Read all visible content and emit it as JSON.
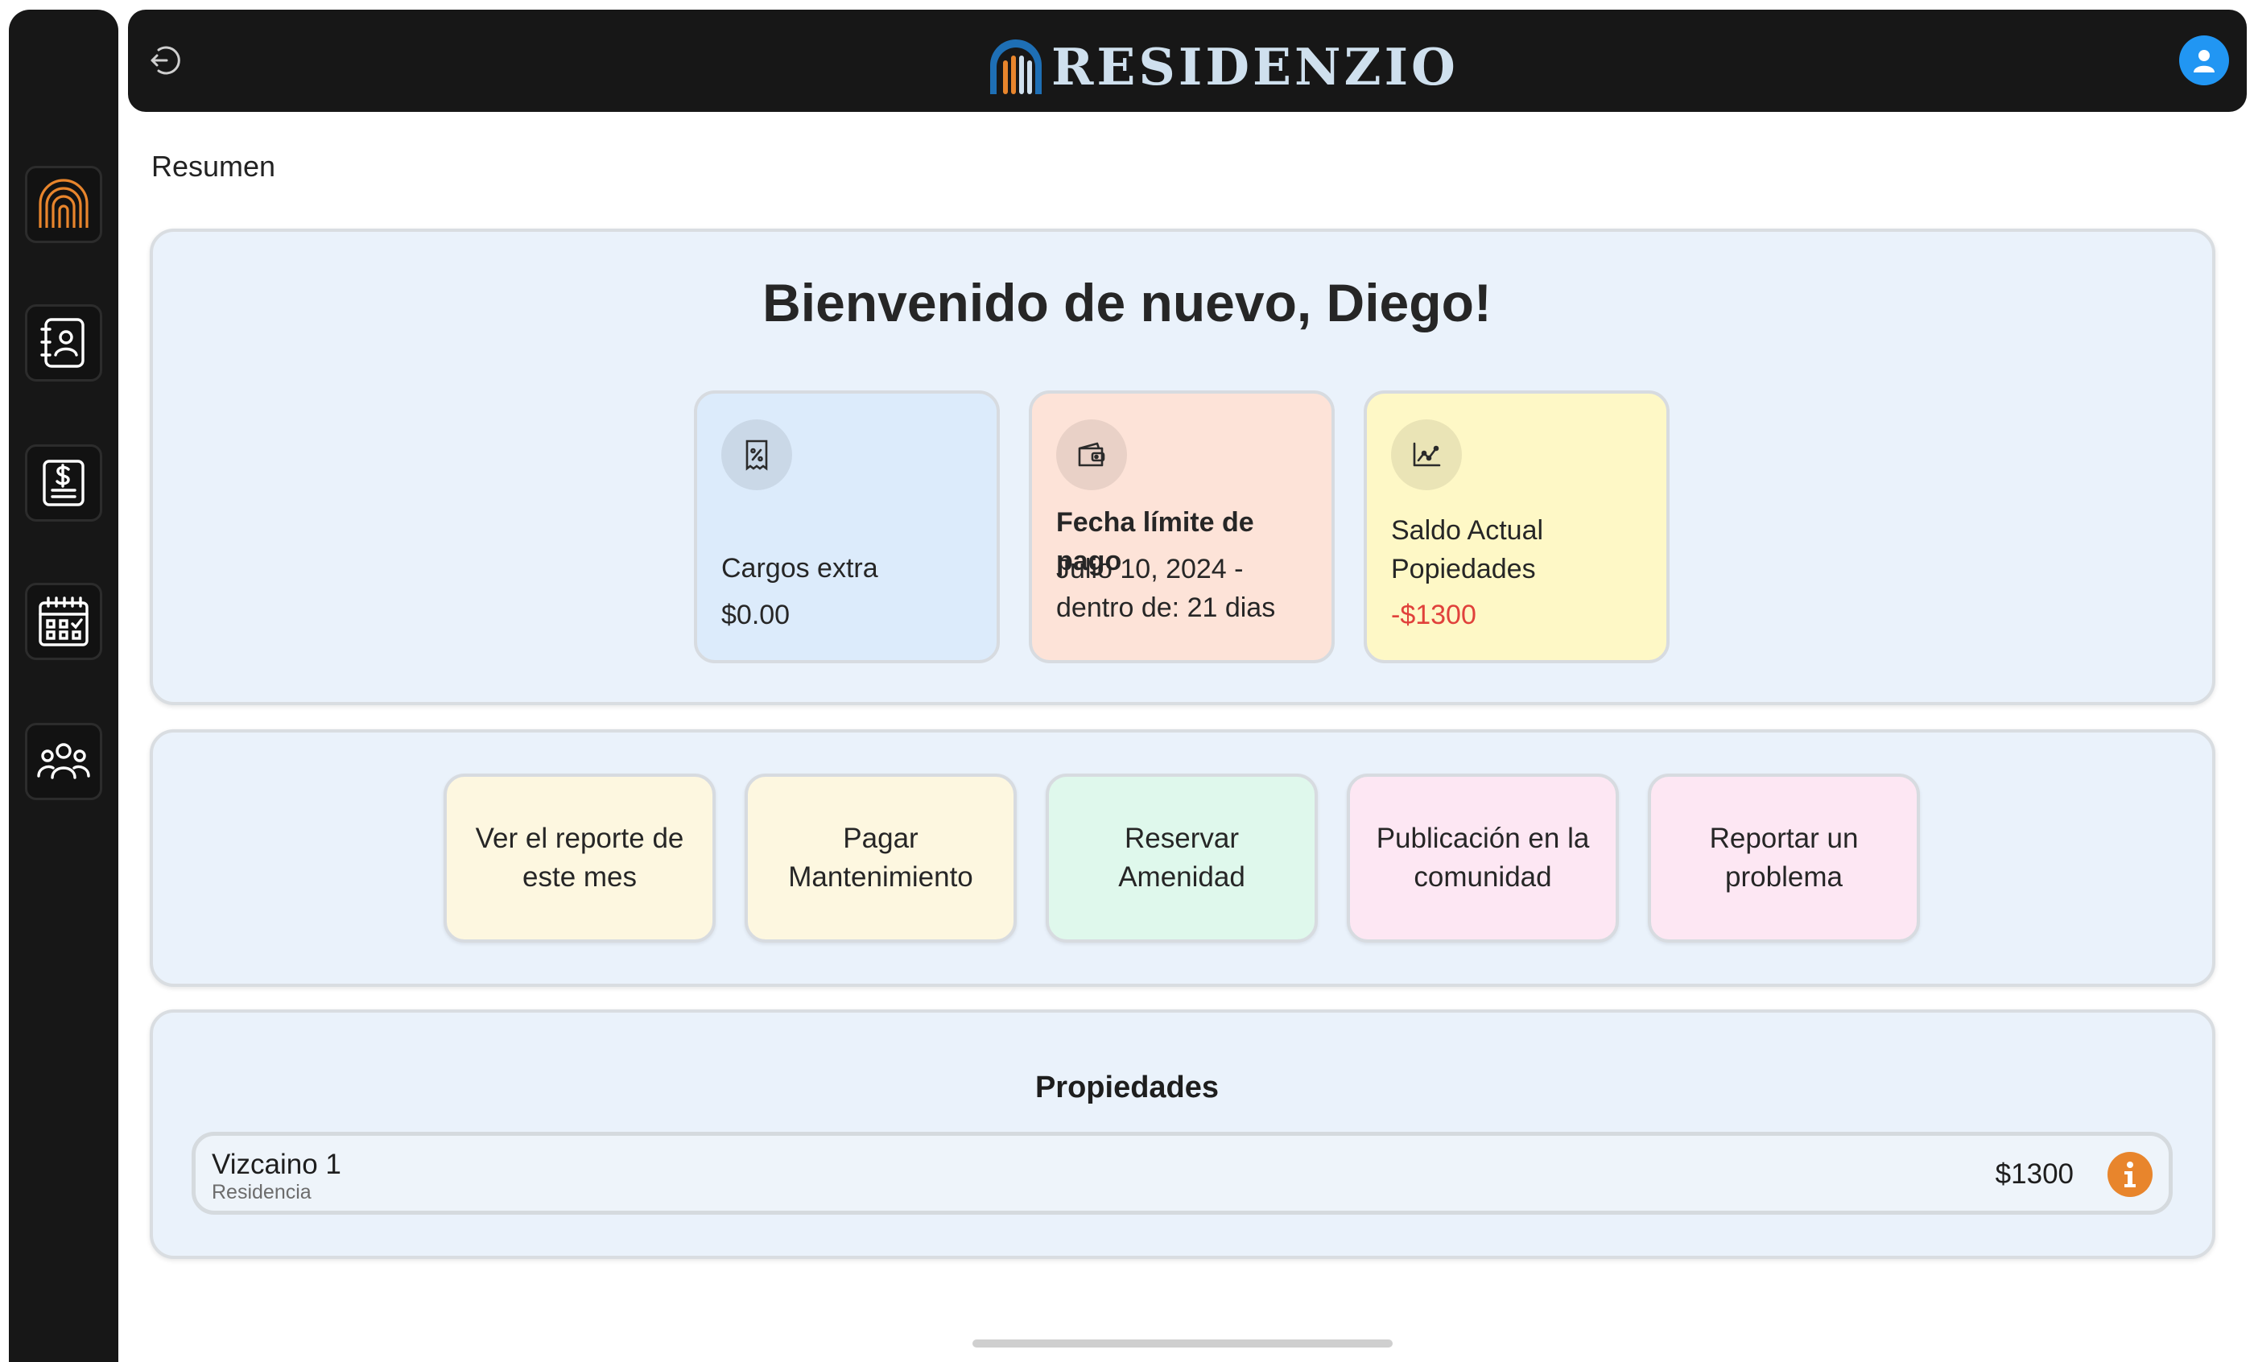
{
  "app": {
    "brand": "RESIDENZIO"
  },
  "colors": {
    "sidebar_bg": "#171717",
    "topbar_bg": "#171717",
    "panel_bg": "#eaf2fb",
    "accent_orange": "#e8852c",
    "brand_blue": "#1e6fb5",
    "avatar_blue": "#2196f3",
    "negative_red": "#e0413b"
  },
  "sidebar": {
    "items": [
      {
        "icon": "residenzio-logo-icon"
      },
      {
        "icon": "contacts-book-icon"
      },
      {
        "icon": "invoice-dollar-icon"
      },
      {
        "icon": "calendar-icon"
      },
      {
        "icon": "community-people-icon"
      }
    ]
  },
  "topbar": {
    "left_icon": "logout-icon",
    "right_icon": "user-avatar-icon"
  },
  "page": {
    "title": "Resumen"
  },
  "welcome": {
    "heading": "Bienvenido de nuevo, Diego!"
  },
  "stats": [
    {
      "icon": "receipt-percent-icon",
      "label": "Cargos extra",
      "value": "$0.00",
      "bg": "#dcebfb"
    },
    {
      "icon": "wallet-icon",
      "label": "Fecha límite de pago",
      "value": "Julio 10, 2024 - dentro de: 21 dias",
      "bg": "#fde3d8"
    },
    {
      "icon": "chart-line-icon",
      "label": "Saldo Actual Popiedades",
      "value": "-$1300",
      "bg": "#fef8c6"
    }
  ],
  "actions": [
    {
      "label": "Ver el reporte de este mes",
      "bg": "#fdf7e0"
    },
    {
      "label": "Pagar Mantenimiento",
      "bg": "#fdf7e0"
    },
    {
      "label": "Reservar Amenidad",
      "bg": "#dff8ec"
    },
    {
      "label": "Publicación en la comunidad",
      "bg": "#fde7f3"
    },
    {
      "label": "Reportar un problema",
      "bg": "#fde7f3"
    }
  ],
  "properties": {
    "title": "Propiedades",
    "items": [
      {
        "name": "Vizcaino 1",
        "type": "Residencia",
        "amount": "$1300",
        "icon": "info-icon"
      }
    ]
  }
}
